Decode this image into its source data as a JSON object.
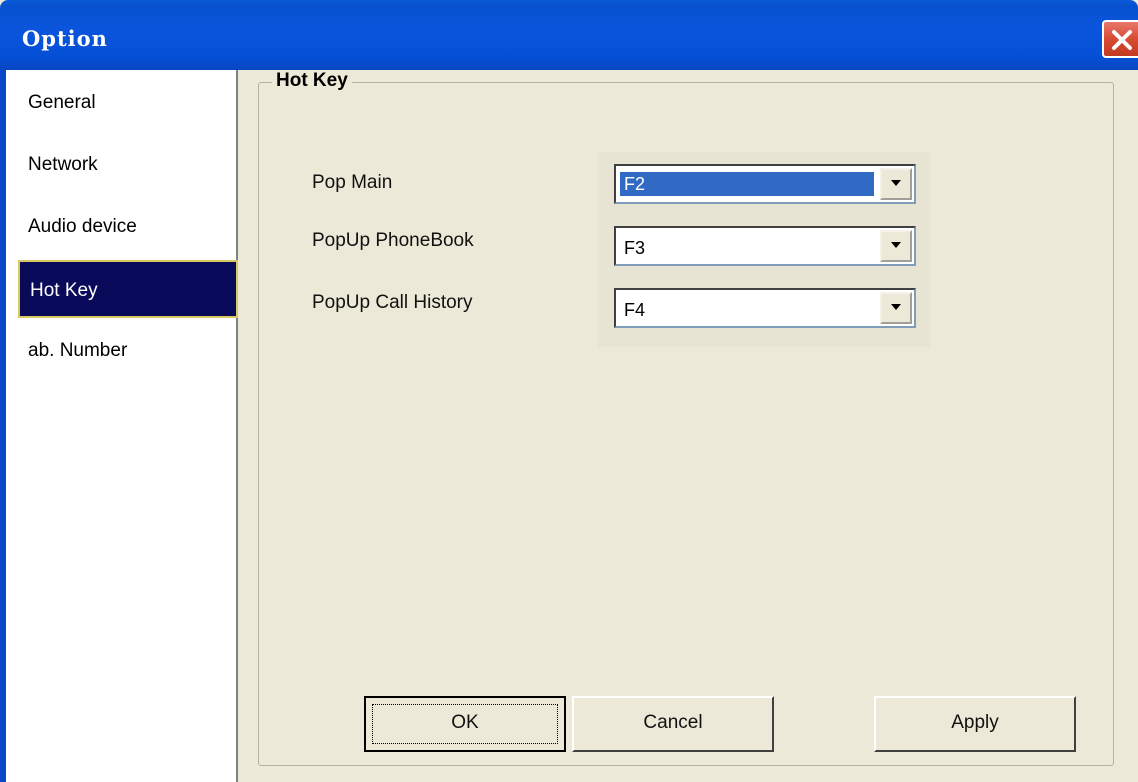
{
  "window": {
    "title": "Option"
  },
  "sidebar": {
    "items": [
      {
        "label": "General",
        "selected": false
      },
      {
        "label": "Network",
        "selected": false
      },
      {
        "label": "Audio device",
        "selected": false
      },
      {
        "label": "Hot Key",
        "selected": true
      },
      {
        "label": "ab. Number",
        "selected": false
      }
    ]
  },
  "hotkey": {
    "group_title": "Hot Key",
    "fields": [
      {
        "label": "Pop Main",
        "value": "F2"
      },
      {
        "label": "PopUp PhoneBook",
        "value": "F3"
      },
      {
        "label": "PopUp Call History",
        "value": "F4"
      }
    ]
  },
  "buttons": {
    "ok": "OK",
    "cancel": "Cancel",
    "apply": "Apply"
  },
  "colors": {
    "titlebar": "#0a55dc",
    "selection": "#0a0a5a",
    "highlight": "#316ac5",
    "background": "#ece9d8"
  }
}
